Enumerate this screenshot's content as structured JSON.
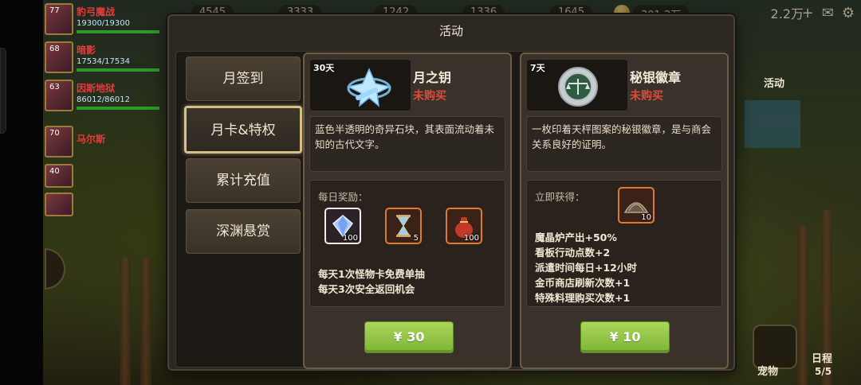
{
  "background": {
    "resources": [
      "4545",
      "3333",
      "1242",
      "1336",
      "1645",
      "301.2万"
    ],
    "gems": "2.2万",
    "roster": [
      {
        "level": "77",
        "name": "豹弓魔战",
        "hp": "19300/19300"
      },
      {
        "level": "68",
        "name": "暗影",
        "hp": "17534/17534"
      },
      {
        "level": "63",
        "name": "因斯地狱",
        "hp": "86012/86012"
      },
      {
        "level": "70",
        "name": "马尔斯",
        "hp": ""
      },
      {
        "level": "40",
        "name": "",
        "hp": ""
      },
      {
        "level": "",
        "name": "",
        "hp": ""
      }
    ],
    "side_labels": {
      "activity": "活动",
      "pet": "宠物",
      "schedule": "日程",
      "schedule_count": "5/5"
    }
  },
  "dialog": {
    "title": "活动",
    "tabs": [
      {
        "label": "月签到",
        "active": false
      },
      {
        "label": "月卡&特权",
        "active": true
      },
      {
        "label": "累计充值",
        "active": false
      },
      {
        "label": "深渊悬赏",
        "active": false
      }
    ],
    "cards": [
      {
        "days": "30天",
        "name": "月之钥",
        "status": "未购买",
        "icon": "crystal-key-icon",
        "desc": "蓝色半透明的奇异石块，其表面流动着未知的古代文字。",
        "box_label": "每日奖励：",
        "items": [
          {
            "icon": "diamond-icon",
            "qty": "100",
            "frame": "white"
          },
          {
            "icon": "hourglass-icon",
            "qty": "5",
            "frame": "orange"
          },
          {
            "icon": "money-bag-icon",
            "qty": "100",
            "frame": "orange"
          }
        ],
        "lines": [
          "每天1次怪物卡免费单抽",
          "每天3次安全返回机会"
        ],
        "price": "¥ 30"
      },
      {
        "days": "7天",
        "name": "秘银徽章",
        "status": "未购买",
        "icon": "mithril-badge-icon",
        "desc": "一枚印着天枰图案的秘银徽章，是与商会关系良好的证明。",
        "box_label": "立即获得：",
        "items": [
          {
            "icon": "tent-icon",
            "qty": "10",
            "frame": "orange"
          }
        ],
        "lines": [
          "魔晶炉产出+50%",
          "看板行动点数+2",
          "派遣时间每日+12小时",
          "金币商店刷新次数+1",
          "特殊料理购买次数+1"
        ],
        "price": "¥ 10"
      }
    ]
  },
  "colors": {
    "accent_gold": "#d6c089",
    "buy_green": "#8cc43e",
    "status_red": "#e04a3c",
    "rare_orange": "#e07a30"
  }
}
